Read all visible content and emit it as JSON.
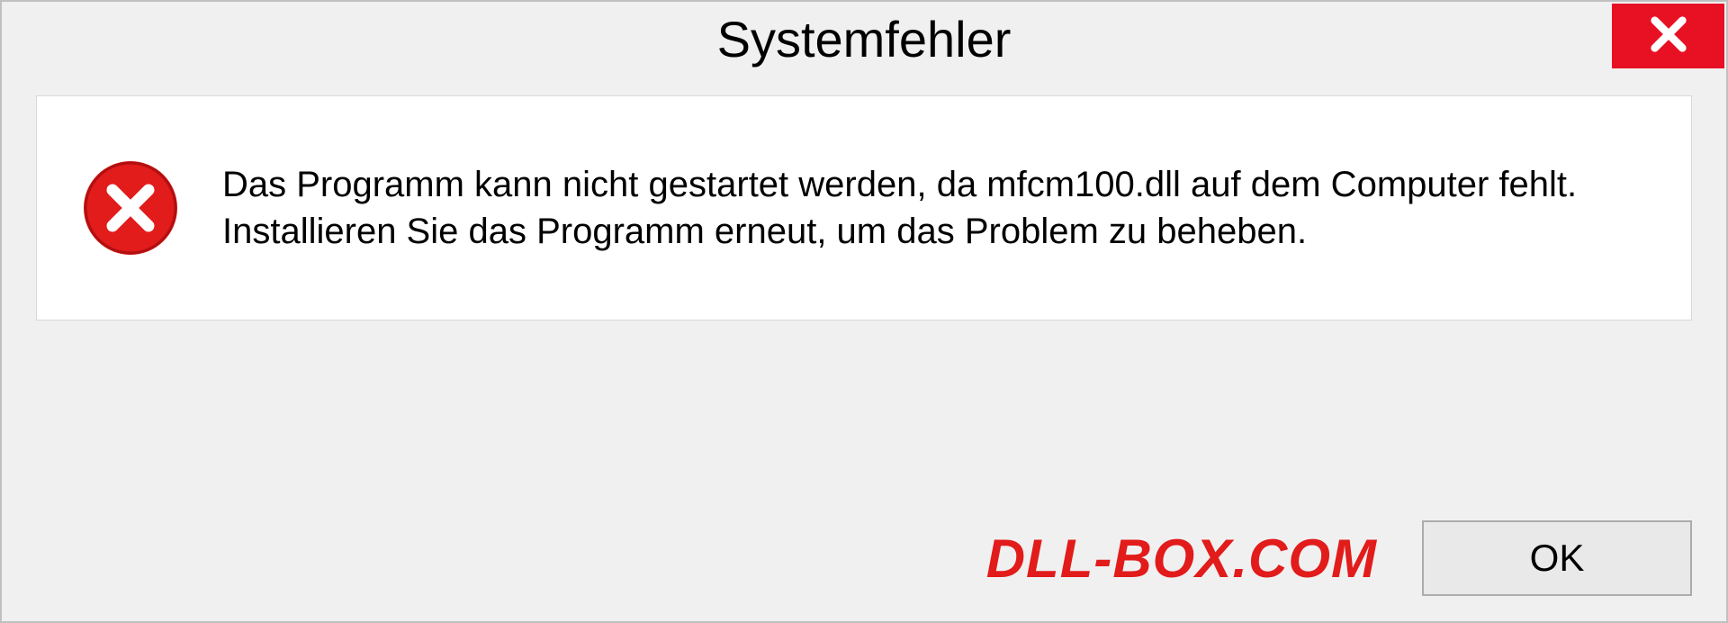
{
  "dialog": {
    "title": "Systemfehler",
    "message": "Das Programm kann nicht gestartet werden, da mfcm100.dll auf dem Computer fehlt. Installieren Sie das Programm erneut, um das Problem zu beheben.",
    "ok_label": "OK"
  },
  "watermark": "DLL-BOX.COM"
}
